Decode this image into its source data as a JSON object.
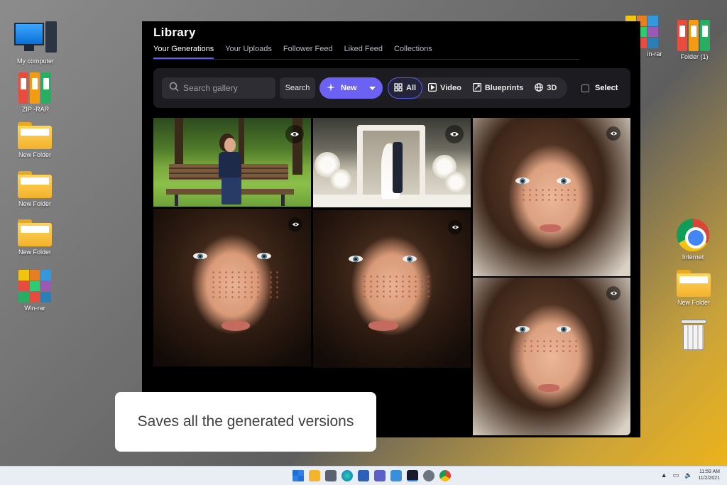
{
  "desktop": {
    "left_icons": [
      {
        "label": "My computer"
      },
      {
        "label": "ZIP -RAR"
      },
      {
        "label": "New Folder"
      },
      {
        "label": "New Folder"
      },
      {
        "label": "New Folder"
      },
      {
        "label": "Win-rar"
      }
    ],
    "right_icons": [
      {
        "label": "in-rar"
      },
      {
        "label": "Folder (1)"
      },
      {
        "label": "Internet"
      },
      {
        "label": "New Folder"
      }
    ]
  },
  "app": {
    "title": "Library",
    "tabs": [
      {
        "label": "Your Generations",
        "active": true
      },
      {
        "label": "Your Uploads"
      },
      {
        "label": "Follower Feed"
      },
      {
        "label": "Liked Feed"
      },
      {
        "label": "Collections"
      }
    ],
    "toolbar": {
      "search_placeholder": "Search gallery",
      "search_button": "Search",
      "new_button": "New",
      "filters": [
        {
          "label": "All",
          "icon": "grid-icon",
          "active": true
        },
        {
          "label": "Video",
          "icon": "play-icon"
        },
        {
          "label": "Blueprints",
          "icon": "blueprint-icon"
        },
        {
          "label": "3D",
          "icon": "globe-icon"
        }
      ],
      "select_label": "Select"
    },
    "accent_color": "#6b62f3"
  },
  "caption": {
    "text": "Saves all the generated versions"
  },
  "taskbar": {
    "time": "11:59 AM",
    "date": "11/2/2021"
  }
}
